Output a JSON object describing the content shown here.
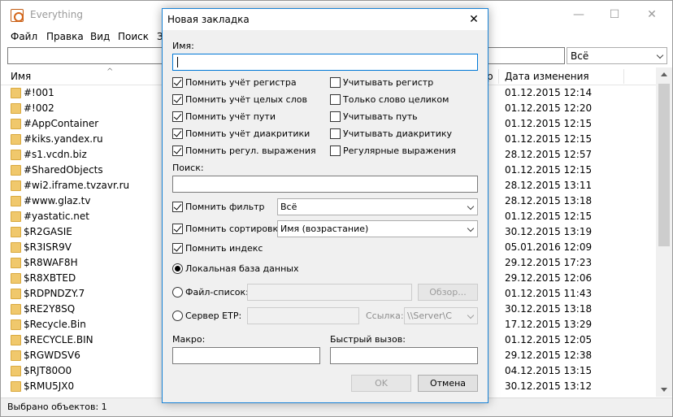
{
  "app": {
    "title": "Everything",
    "minimize": "—",
    "maximize": "☐",
    "close": "✕"
  },
  "menu": [
    "Файл",
    "Правка",
    "Вид",
    "Поиск",
    "З"
  ],
  "filter": {
    "value": "Всё"
  },
  "columns": {
    "name": "Имя",
    "sort_arrow": "^",
    "r": "р",
    "date": "Дата изменения"
  },
  "files": [
    {
      "name": "#!001",
      "date": "01.12.2015 12:14"
    },
    {
      "name": "#!002",
      "date": "01.12.2015 12:20"
    },
    {
      "name": "#AppContainer",
      "date": "01.12.2015 12:15"
    },
    {
      "name": "#kiks.yandex.ru",
      "date": "01.12.2015 12:15"
    },
    {
      "name": "#s1.vcdn.biz",
      "date": "28.12.2015 12:57"
    },
    {
      "name": "#SharedObjects",
      "date": "01.12.2015 12:15"
    },
    {
      "name": "#wi2.iframe.tvzavr.ru",
      "date": "28.12.2015 13:11"
    },
    {
      "name": "#www.glaz.tv",
      "date": "28.12.2015 13:18"
    },
    {
      "name": "#yastatic.net",
      "date": "01.12.2015 12:15"
    },
    {
      "name": "$R2GASIE",
      "date": "30.12.2015 13:19"
    },
    {
      "name": "$R3ISR9V",
      "date": "05.01.2016 12:09"
    },
    {
      "name": "$R8WAF8H",
      "date": "29.12.2015 17:23"
    },
    {
      "name": "$R8XBTED",
      "date": "29.12.2015 12:06"
    },
    {
      "name": "$RDPNDZY.7",
      "date": "01.12.2015 11:43"
    },
    {
      "name": "$RE2Y8SQ",
      "date": "30.12.2015 13:18"
    },
    {
      "name": "$Recycle.Bin",
      "date": "17.12.2015 13:29"
    },
    {
      "name": "$RECYCLE.BIN",
      "date": "01.12.2015 12:05"
    },
    {
      "name": "$RGWDSV6",
      "date": "29.12.2015 12:38"
    },
    {
      "name": "$RJT80O0",
      "date": "04.12.2015 13:15"
    },
    {
      "name": "$RMU5JX0",
      "date": "30.12.2015 13:12"
    }
  ],
  "status": "Выбрано объектов: 1",
  "dialog": {
    "title": "Новая закладка",
    "close": "✕",
    "name_label": "Имя:",
    "name_value": "",
    "options_left": [
      {
        "label": "Помнить учёт регистра",
        "checked": true
      },
      {
        "label": "Помнить учёт целых слов",
        "checked": true
      },
      {
        "label": "Помнить учёт пути",
        "checked": true
      },
      {
        "label": "Помнить учёт диакритики",
        "checked": true
      },
      {
        "label": "Помнить регул. выражения",
        "checked": true
      }
    ],
    "options_right": [
      {
        "label": "Учитывать регистр",
        "checked": false
      },
      {
        "label": "Только слово целиком",
        "checked": false
      },
      {
        "label": "Учитывать путь",
        "checked": false
      },
      {
        "label": "Учитывать диакритику",
        "checked": false
      },
      {
        "label": "Регулярные выражения",
        "checked": false
      }
    ],
    "search_label": "Поиск:",
    "search_value": "",
    "remember_filter": "Помнить фильтр",
    "filter_value": "Всё",
    "remember_sort": "Помнить сортировку",
    "sort_value": "Имя (возрастание)",
    "remember_index": "Помнить индекс",
    "local_db": "Локальная база данных",
    "file_list": "Файл-список:",
    "browse": "Обзор...",
    "ftp_server": "Сервер ETP:",
    "link_label": "Ссылка:",
    "link_value": "\\\\Server\\C",
    "macro_label": "Макро:",
    "hotkey_label": "Быстрый вызов:",
    "ok": "OK",
    "cancel": "Отмена"
  }
}
